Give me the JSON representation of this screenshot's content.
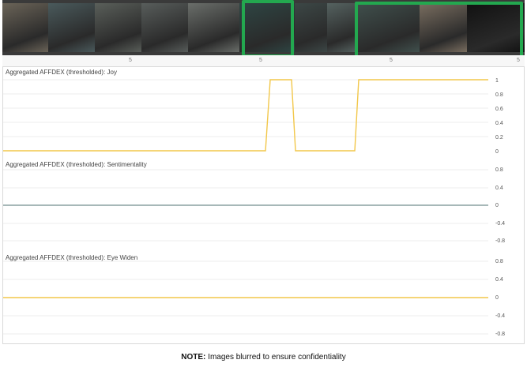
{
  "filmstrip": {
    "frame_colors": [
      "#6b6458",
      "#4a5a5c",
      "#5a5f5a",
      "#585d5b",
      "#6a6e6a",
      "#2e4644",
      "#3c4746",
      "#556260",
      "#40504d",
      "#7a6e60",
      "#111111"
    ],
    "highlight_color": "#23a84f"
  },
  "ruler": {
    "ticks": [
      "5",
      "5",
      "5",
      "5"
    ]
  },
  "panels": [
    {
      "title": "Aggregated AFFDEX (thresholded): Joy",
      "line_color": "#f2c74a",
      "y_ticks": [
        "1",
        "0.8",
        "0.6",
        "0.4",
        "0.2",
        "0"
      ]
    },
    {
      "title": "Aggregated AFFDEX (thresholded): Sentimentality",
      "line_color": "#8aa0a0",
      "y_ticks": [
        "0.8",
        "0.4",
        "0",
        "-0.4",
        "-0.8"
      ]
    },
    {
      "title": "Aggregated AFFDEX (thresholded): Eye Widen",
      "line_color": "#f2c74a",
      "y_ticks": [
        "0.8",
        "0.4",
        "0",
        "-0.4",
        "-0.8"
      ]
    }
  ],
  "footer": {
    "note_label": "NOTE:",
    "note_text": " Images blurred to ensure confidentiality"
  }
}
